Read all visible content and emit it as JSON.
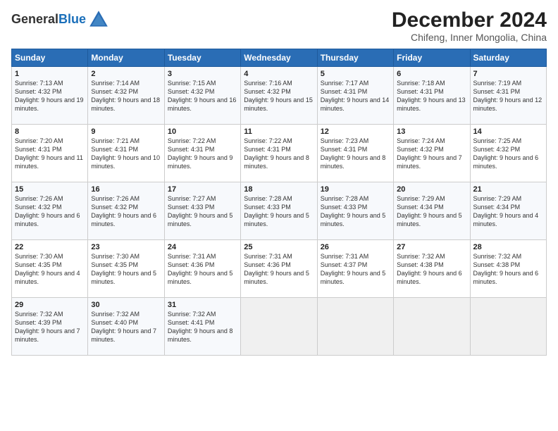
{
  "logo": {
    "general": "General",
    "blue": "Blue"
  },
  "title": "December 2024",
  "subtitle": "Chifeng, Inner Mongolia, China",
  "weekdays": [
    "Sunday",
    "Monday",
    "Tuesday",
    "Wednesday",
    "Thursday",
    "Friday",
    "Saturday"
  ],
  "weeks": [
    [
      {
        "day": "1",
        "sunrise": "7:13 AM",
        "sunset": "4:32 PM",
        "daylight": "9 hours and 19 minutes."
      },
      {
        "day": "2",
        "sunrise": "7:14 AM",
        "sunset": "4:32 PM",
        "daylight": "9 hours and 18 minutes."
      },
      {
        "day": "3",
        "sunrise": "7:15 AM",
        "sunset": "4:32 PM",
        "daylight": "9 hours and 16 minutes."
      },
      {
        "day": "4",
        "sunrise": "7:16 AM",
        "sunset": "4:32 PM",
        "daylight": "9 hours and 15 minutes."
      },
      {
        "day": "5",
        "sunrise": "7:17 AM",
        "sunset": "4:31 PM",
        "daylight": "9 hours and 14 minutes."
      },
      {
        "day": "6",
        "sunrise": "7:18 AM",
        "sunset": "4:31 PM",
        "daylight": "9 hours and 13 minutes."
      },
      {
        "day": "7",
        "sunrise": "7:19 AM",
        "sunset": "4:31 PM",
        "daylight": "9 hours and 12 minutes."
      }
    ],
    [
      {
        "day": "8",
        "sunrise": "7:20 AM",
        "sunset": "4:31 PM",
        "daylight": "9 hours and 11 minutes."
      },
      {
        "day": "9",
        "sunrise": "7:21 AM",
        "sunset": "4:31 PM",
        "daylight": "9 hours and 10 minutes."
      },
      {
        "day": "10",
        "sunrise": "7:22 AM",
        "sunset": "4:31 PM",
        "daylight": "9 hours and 9 minutes."
      },
      {
        "day": "11",
        "sunrise": "7:22 AM",
        "sunset": "4:31 PM",
        "daylight": "9 hours and 8 minutes."
      },
      {
        "day": "12",
        "sunrise": "7:23 AM",
        "sunset": "4:31 PM",
        "daylight": "9 hours and 8 minutes."
      },
      {
        "day": "13",
        "sunrise": "7:24 AM",
        "sunset": "4:32 PM",
        "daylight": "9 hours and 7 minutes."
      },
      {
        "day": "14",
        "sunrise": "7:25 AM",
        "sunset": "4:32 PM",
        "daylight": "9 hours and 6 minutes."
      }
    ],
    [
      {
        "day": "15",
        "sunrise": "7:26 AM",
        "sunset": "4:32 PM",
        "daylight": "9 hours and 6 minutes."
      },
      {
        "day": "16",
        "sunrise": "7:26 AM",
        "sunset": "4:32 PM",
        "daylight": "9 hours and 6 minutes."
      },
      {
        "day": "17",
        "sunrise": "7:27 AM",
        "sunset": "4:33 PM",
        "daylight": "9 hours and 5 minutes."
      },
      {
        "day": "18",
        "sunrise": "7:28 AM",
        "sunset": "4:33 PM",
        "daylight": "9 hours and 5 minutes."
      },
      {
        "day": "19",
        "sunrise": "7:28 AM",
        "sunset": "4:33 PM",
        "daylight": "9 hours and 5 minutes."
      },
      {
        "day": "20",
        "sunrise": "7:29 AM",
        "sunset": "4:34 PM",
        "daylight": "9 hours and 5 minutes."
      },
      {
        "day": "21",
        "sunrise": "7:29 AM",
        "sunset": "4:34 PM",
        "daylight": "9 hours and 4 minutes."
      }
    ],
    [
      {
        "day": "22",
        "sunrise": "7:30 AM",
        "sunset": "4:35 PM",
        "daylight": "9 hours and 4 minutes."
      },
      {
        "day": "23",
        "sunrise": "7:30 AM",
        "sunset": "4:35 PM",
        "daylight": "9 hours and 5 minutes."
      },
      {
        "day": "24",
        "sunrise": "7:31 AM",
        "sunset": "4:36 PM",
        "daylight": "9 hours and 5 minutes."
      },
      {
        "day": "25",
        "sunrise": "7:31 AM",
        "sunset": "4:36 PM",
        "daylight": "9 hours and 5 minutes."
      },
      {
        "day": "26",
        "sunrise": "7:31 AM",
        "sunset": "4:37 PM",
        "daylight": "9 hours and 5 minutes."
      },
      {
        "day": "27",
        "sunrise": "7:32 AM",
        "sunset": "4:38 PM",
        "daylight": "9 hours and 6 minutes."
      },
      {
        "day": "28",
        "sunrise": "7:32 AM",
        "sunset": "4:38 PM",
        "daylight": "9 hours and 6 minutes."
      }
    ],
    [
      {
        "day": "29",
        "sunrise": "7:32 AM",
        "sunset": "4:39 PM",
        "daylight": "9 hours and 7 minutes."
      },
      {
        "day": "30",
        "sunrise": "7:32 AM",
        "sunset": "4:40 PM",
        "daylight": "9 hours and 7 minutes."
      },
      {
        "day": "31",
        "sunrise": "7:32 AM",
        "sunset": "4:41 PM",
        "daylight": "9 hours and 8 minutes."
      },
      null,
      null,
      null,
      null
    ]
  ],
  "labels": {
    "sunrise": "Sunrise:",
    "sunset": "Sunset:",
    "daylight": "Daylight:"
  }
}
